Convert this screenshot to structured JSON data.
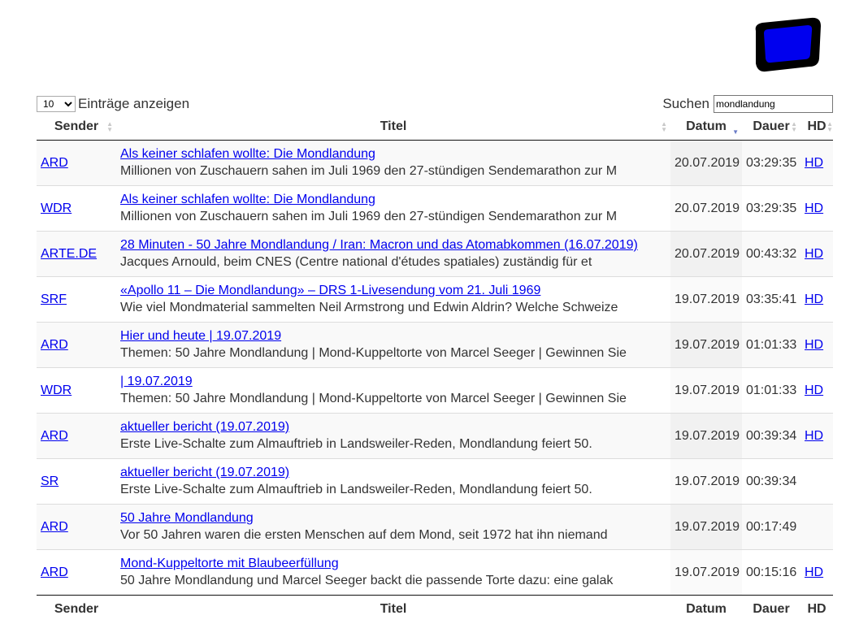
{
  "length_control": {
    "selected": "10",
    "label": "Einträge anzeigen"
  },
  "search": {
    "label": "Suchen",
    "value": "mondlandung"
  },
  "columns": {
    "sender": "Sender",
    "titel": "Titel",
    "datum": "Datum",
    "dauer": "Dauer",
    "hd": "HD"
  },
  "rows": [
    {
      "sender": "ARD",
      "title": "Als keiner schlafen wollte: Die Mondlandung",
      "description": "Millionen von Zuschauern sahen im Juli 1969 den 27-stündigen Sendemarathon zur M",
      "date": "20.07.2019",
      "duration": "03:29:35",
      "hd": "HD"
    },
    {
      "sender": "WDR",
      "title": "Als keiner schlafen wollte: Die Mondlandung",
      "description": "Millionen von Zuschauern sahen im Juli 1969 den 27-stündigen Sendemarathon zur M",
      "date": "20.07.2019",
      "duration": "03:29:35",
      "hd": "HD"
    },
    {
      "sender": "ARTE.DE",
      "title": "28 Minuten - 50 Jahre Mondlandung / Iran: Macron und das Atomabkommen (16.07.2019)",
      "description": "Jacques Arnould, beim CNES (Centre national d'études spatiales) zuständig für et",
      "date": "20.07.2019",
      "duration": "00:43:32",
      "hd": "HD"
    },
    {
      "sender": "SRF",
      "title": "«Apollo 11 – Die Mondlandung» – DRS 1-Livesendung vom 21. Juli 1969",
      "description": "Wie viel Mondmaterial sammelten Neil Armstrong und Edwin Aldrin? Welche Schweize",
      "date": "19.07.2019",
      "duration": "03:35:41",
      "hd": "HD"
    },
    {
      "sender": "ARD",
      "title": "Hier und heute | 19.07.2019",
      "description": "Themen: 50 Jahre Mondlandung | Mond-Kuppeltorte von Marcel Seeger | Gewinnen Sie",
      "date": "19.07.2019",
      "duration": "01:01:33",
      "hd": "HD"
    },
    {
      "sender": "WDR",
      "title": "| 19.07.2019",
      "description": "Themen: 50 Jahre Mondlandung | Mond-Kuppeltorte von Marcel Seeger | Gewinnen Sie",
      "date": "19.07.2019",
      "duration": "01:01:33",
      "hd": "HD"
    },
    {
      "sender": "ARD",
      "title": "aktueller bericht (19.07.2019)",
      "description": "Erste Live-Schalte zum Almauftrieb in Landsweiler-Reden, Mondlandung feiert 50.",
      "date": "19.07.2019",
      "duration": "00:39:34",
      "hd": "HD"
    },
    {
      "sender": "SR",
      "title": "aktueller bericht (19.07.2019)",
      "description": "Erste Live-Schalte zum Almauftrieb in Landsweiler-Reden, Mondlandung feiert 50.",
      "date": "19.07.2019",
      "duration": "00:39:34",
      "hd": ""
    },
    {
      "sender": "ARD",
      "title": "50 Jahre Mondlandung",
      "description": "Vor 50 Jahren waren die ersten Menschen auf dem Mond, seit 1972 hat ihn niemand",
      "date": "19.07.2019",
      "duration": "00:17:49",
      "hd": ""
    },
    {
      "sender": "ARD",
      "title": "Mond-Kuppeltorte mit Blaubeerfüllung",
      "description": "50 Jahre Mondlandung und Marcel Seeger backt die passende Torte dazu: eine galak",
      "date": "19.07.2019",
      "duration": "00:15:16",
      "hd": "HD"
    }
  ]
}
